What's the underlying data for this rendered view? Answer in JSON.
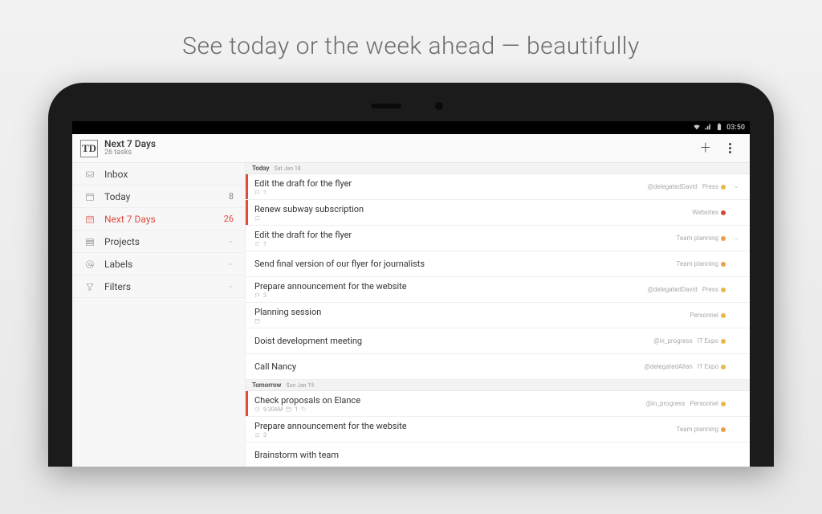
{
  "caption": "See today or the week ahead — beautifully",
  "status": {
    "time": "03:50"
  },
  "header": {
    "logo": "TD",
    "title": "Next 7 Days",
    "subtitle": "26 tasks"
  },
  "sidebar": {
    "items": [
      {
        "id": "inbox",
        "label": "Inbox",
        "count": "",
        "expandable": false
      },
      {
        "id": "today",
        "label": "Today",
        "count": "8",
        "expandable": false
      },
      {
        "id": "next7",
        "label": "Next 7 Days",
        "count": "26",
        "expandable": false,
        "active": true
      },
      {
        "id": "projects",
        "label": "Projects",
        "count": "",
        "expandable": true
      },
      {
        "id": "labels",
        "label": "Labels",
        "count": "",
        "expandable": true
      },
      {
        "id": "filters",
        "label": "Filters",
        "count": "",
        "expandable": true
      }
    ]
  },
  "sections": [
    {
      "day": "Today",
      "date": "Sat Jan 18",
      "tasks": [
        {
          "title": "Edit the draft for the flyer",
          "priority": true,
          "meta_icon": "comment",
          "meta_text": "1",
          "labels": [
            "@delegatedDavid"
          ],
          "project": "Press",
          "project_color": "#e8b84a",
          "expandable": true
        },
        {
          "title": "Renew subway subscription",
          "priority": true,
          "meta_icon": "repeat",
          "meta_text": "",
          "labels": [],
          "project": "Websites",
          "project_color": "#d34836",
          "expandable": false
        },
        {
          "title": "Edit the draft for the flyer",
          "priority": false,
          "meta_icon": "subtask",
          "meta_text": "1",
          "labels": [],
          "project": "Team planning",
          "project_color": "#e8a04a",
          "expandable": true
        },
        {
          "title": "Send final version of our flyer for journalists",
          "priority": false,
          "meta_icon": "",
          "meta_text": "",
          "labels": [],
          "project": "Team planning",
          "project_color": "#e8a04a",
          "expandable": false
        },
        {
          "title": "Prepare announcement for the website",
          "priority": false,
          "meta_icon": "comment",
          "meta_text": "3",
          "labels": [
            "@delegatedDavid"
          ],
          "project": "Press",
          "project_color": "#e8b84a",
          "expandable": false
        },
        {
          "title": "Planning session",
          "priority": false,
          "meta_icon": "date",
          "meta_text": "",
          "labels": [],
          "project": "Personnel",
          "project_color": "#e8b84a",
          "expandable": false
        },
        {
          "title": "Doist development meeting",
          "priority": false,
          "meta_icon": "",
          "meta_text": "",
          "labels": [
            "@in_progress"
          ],
          "project": "IT Expo",
          "project_color": "#e8b84a",
          "expandable": false
        },
        {
          "title": "Call Nancy",
          "priority": false,
          "meta_icon": "",
          "meta_text": "",
          "labels": [
            "@delegatedAllan"
          ],
          "project": "IT Expo",
          "project_color": "#e8b84a",
          "expandable": false
        }
      ]
    },
    {
      "day": "Tomorrow",
      "date": "Sun Jan 19",
      "tasks": [
        {
          "title": "Check proposals on Elance",
          "priority": true,
          "meta_icon": "clock",
          "meta_text": "9:30AM",
          "meta_extra_icon": "date",
          "meta_extra_text": "1",
          "meta_tag_icon": true,
          "labels": [
            "@in_progress"
          ],
          "project": "Personnel",
          "project_color": "#e8b84a",
          "expandable": false
        },
        {
          "title": "Prepare announcement for the website",
          "priority": false,
          "meta_icon": "subtask",
          "meta_text": "3",
          "labels": [],
          "project": "Team planning",
          "project_color": "#e8a04a",
          "expandable": false
        },
        {
          "title": "Brainstorm with team",
          "priority": false,
          "meta_icon": "",
          "meta_text": "",
          "labels": [],
          "project": "",
          "project_color": "",
          "expandable": false
        }
      ]
    }
  ]
}
